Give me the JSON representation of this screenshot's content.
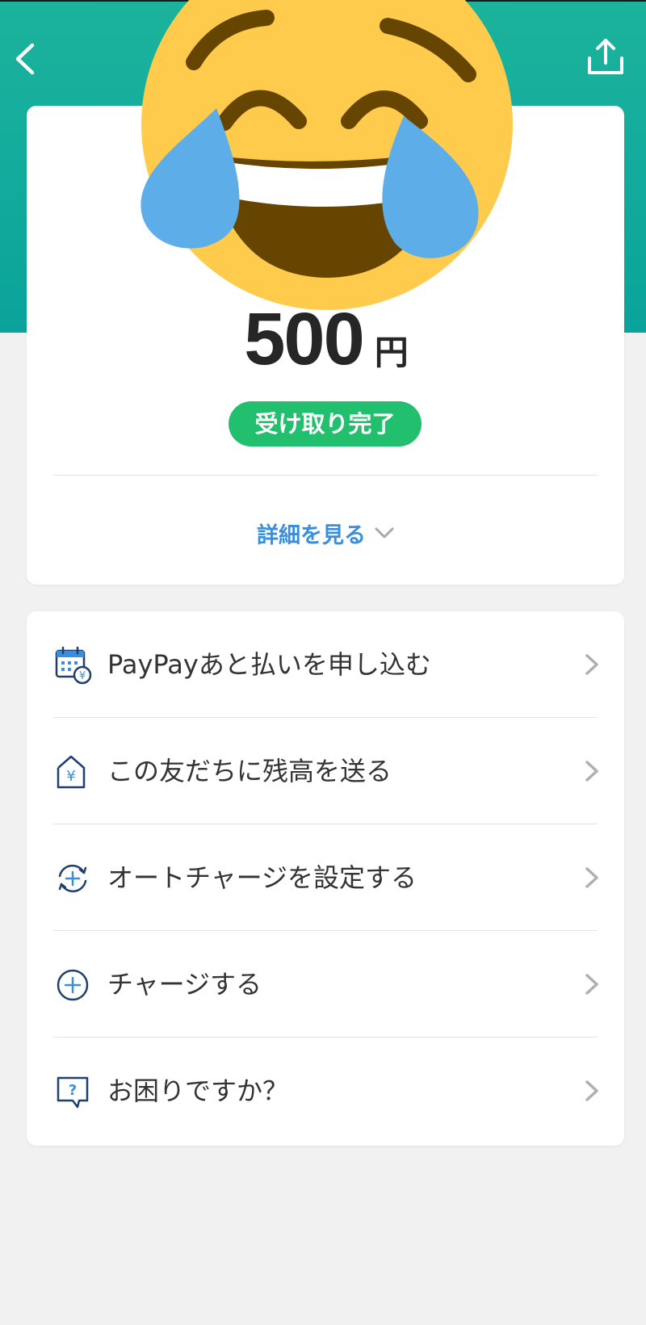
{
  "payment": {
    "amount": "500",
    "currency_unit": "円",
    "status": "受け取り完了",
    "detail_link": "詳細を見る"
  },
  "actions": [
    {
      "label": "PayPayあと払いを申し込む",
      "icon": "calendar-yen-icon"
    },
    {
      "label": "この友だちに残高を送る",
      "icon": "house-yen-icon"
    },
    {
      "label": "オートチャージを設定する",
      "icon": "auto-charge-icon"
    },
    {
      "label": "チャージする",
      "icon": "plus-circle-icon"
    },
    {
      "label": "お困りですか？",
      "icon": "help-question-icon"
    }
  ],
  "colors": {
    "header": "#0aa39b",
    "status_badge": "#22bf6f",
    "link": "#3a8fdc",
    "icon_navy": "#1f3f6e",
    "icon_blue": "#3a8fdc",
    "emoji_yellow": "#ffcb4c",
    "emoji_tear": "#5dade8",
    "emoji_dark": "#664500"
  }
}
